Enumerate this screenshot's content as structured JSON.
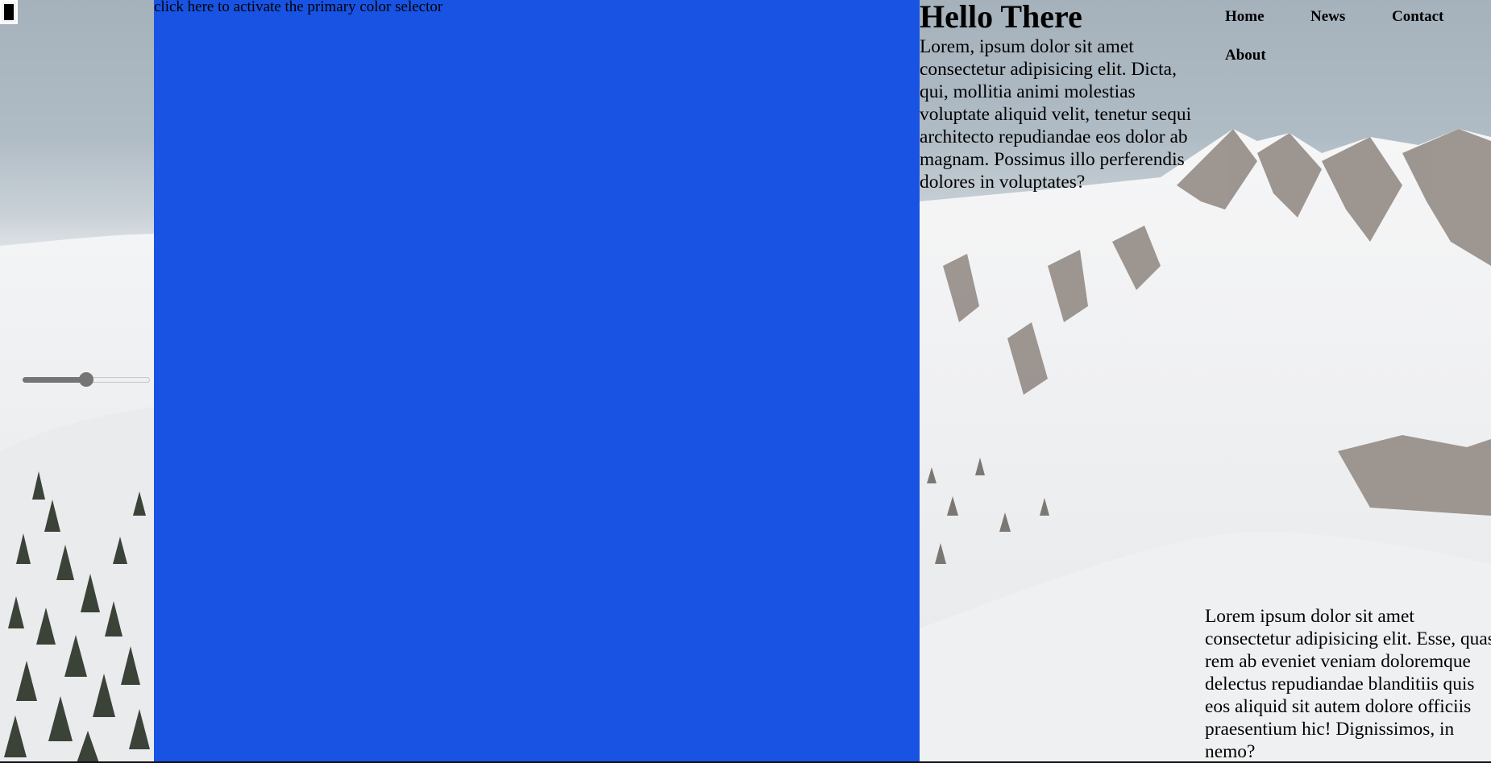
{
  "color_picker": {
    "value": "#000000"
  },
  "range_slider": {
    "value": 0.5
  },
  "blue_panel": {
    "color": "#1953e3",
    "activate_text": "click here to activate the primary color selector"
  },
  "hero": {
    "title": "Hello There",
    "text": "Lorem, ipsum dolor sit amet consectetur adipisicing elit. Dicta, qui, mollitia animi molestias voluptate aliquid velit, tenetur sequi architecto repudiandae eos dolor ab magnam. Possimus illo perferendis dolores in voluptates?"
  },
  "nav": {
    "home": "Home",
    "news": "News",
    "contact": "Contact",
    "about": "About"
  },
  "lower": {
    "text": "Lorem ipsum dolor sit amet consectetur adipisicing elit. Esse, quas rem ab eveniet veniam doloremque delectus repudiandae blanditiis quis eos aliquid sit autem dolore officiis praesentium hic! Dignissimos, in nemo?"
  }
}
